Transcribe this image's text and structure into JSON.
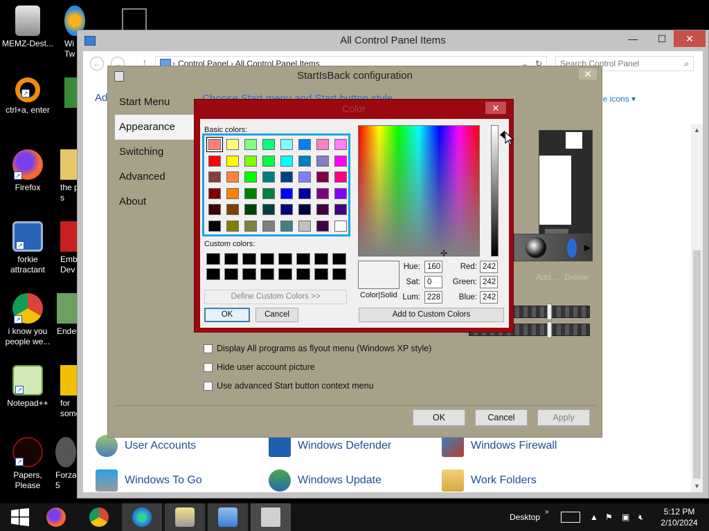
{
  "desktop": {
    "icons": [
      {
        "label": "MEMZ-Dest...",
        "icon": "recycle-bin-icon"
      },
      {
        "label": "ctrl+a, enter",
        "icon": "ring-icon"
      },
      {
        "label": "Firefox",
        "icon": "firefox-icon"
      },
      {
        "label": "forkie attractant",
        "icon": "monitor-gear-icon"
      },
      {
        "label": "i know you people we...",
        "icon": "chrome-icon"
      },
      {
        "label": "Notepad++",
        "icon": "notepadpp-icon"
      },
      {
        "label": "Papers, Please",
        "icon": "papers-please-icon"
      }
    ],
    "clipped": [
      "Wi Tw",
      "Ad",
      "the p s",
      "Emba Dev",
      "Ender",
      "for some",
      "Forza 5"
    ]
  },
  "control_panel": {
    "title": "All Control Panel Items",
    "breadcrumb": [
      "Control Panel",
      "All Control Panel Items"
    ],
    "search_placeholder": "Search Control Panel",
    "adjust_label": "Ad",
    "view_by": "rge icons",
    "items": [
      {
        "label": "User Accounts",
        "icon": "users-icon"
      },
      {
        "label": "Windows Defender",
        "icon": "shield-icon"
      },
      {
        "label": "Windows Firewall",
        "icon": "firewall-icon"
      },
      {
        "label": "Windows To Go",
        "icon": "usb-windows-icon"
      },
      {
        "label": "Windows Update",
        "icon": "update-icon"
      },
      {
        "label": "Work Folders",
        "icon": "folder-icon"
      }
    ]
  },
  "startisback": {
    "title": "StartIsBack configuration",
    "nav": [
      "Start Menu",
      "Appearance",
      "Switching",
      "Advanced",
      "About"
    ],
    "selected_nav": "Appearance",
    "heading": "Choose Start menu and Start button style",
    "checkboxes": [
      {
        "label": "Display All programs as flyout menu (Windows XP style)",
        "checked": false
      },
      {
        "label": "Hide user account picture",
        "checked": false
      },
      {
        "label": "Use advanced Start button context menu",
        "checked": false
      }
    ],
    "add_link": "Add...",
    "delete_link": "Delete",
    "buttons": {
      "ok": "OK",
      "cancel": "Cancel",
      "apply": "Apply"
    }
  },
  "color_dialog": {
    "title": "Color",
    "basic_label": "Basic colors:",
    "custom_label": "Custom colors:",
    "basic_colors": [
      "#ff8080",
      "#ffff80",
      "#80ff80",
      "#00ff80",
      "#80ffff",
      "#0080ff",
      "#ff80c0",
      "#ff80ff",
      "#ff0000",
      "#ffff00",
      "#80ff00",
      "#00ff40",
      "#00ffff",
      "#0080c0",
      "#8080c0",
      "#ff00ff",
      "#804040",
      "#ff8040",
      "#00ff00",
      "#008080",
      "#004080",
      "#8080ff",
      "#800040",
      "#ff0080",
      "#800000",
      "#ff8000",
      "#008000",
      "#008040",
      "#0000ff",
      "#0000a0",
      "#800080",
      "#8000ff",
      "#400000",
      "#804000",
      "#004000",
      "#004040",
      "#000080",
      "#000040",
      "#400040",
      "#400080",
      "#000000",
      "#808000",
      "#808040",
      "#808080",
      "#408080",
      "#c0c0c0",
      "#400040",
      "#ffffff"
    ],
    "selected_index": 0,
    "custom_colors": [
      "#000000",
      "#000000",
      "#000000",
      "#000000",
      "#000000",
      "#000000",
      "#000000",
      "#000000",
      "#000000",
      "#000000",
      "#000000",
      "#000000",
      "#000000",
      "#000000",
      "#000000",
      "#000000"
    ],
    "define_custom": "Define Custom Colors >>",
    "ok": "OK",
    "cancel": "Cancel",
    "color_solid_label": "Color|Solid",
    "add_to_custom": "Add to Custom Colors",
    "fields": {
      "hue_label": "Hue:",
      "hue": "160",
      "sat_label": "Sat:",
      "sat": "0",
      "lum_label": "Lum:",
      "lum": "228",
      "red_label": "Red:",
      "red": "242",
      "green_label": "Green:",
      "green": "242",
      "blue_label": "Blue:",
      "blue": "242"
    }
  },
  "taskbar": {
    "apps": [
      "firefox-icon",
      "chrome-icon",
      "edge-icon",
      "network-user-icon",
      "control-panel-icon",
      "startisback-icon"
    ],
    "desktop_label": "Desktop",
    "time": "5:12 PM",
    "date": "2/10/2024"
  }
}
